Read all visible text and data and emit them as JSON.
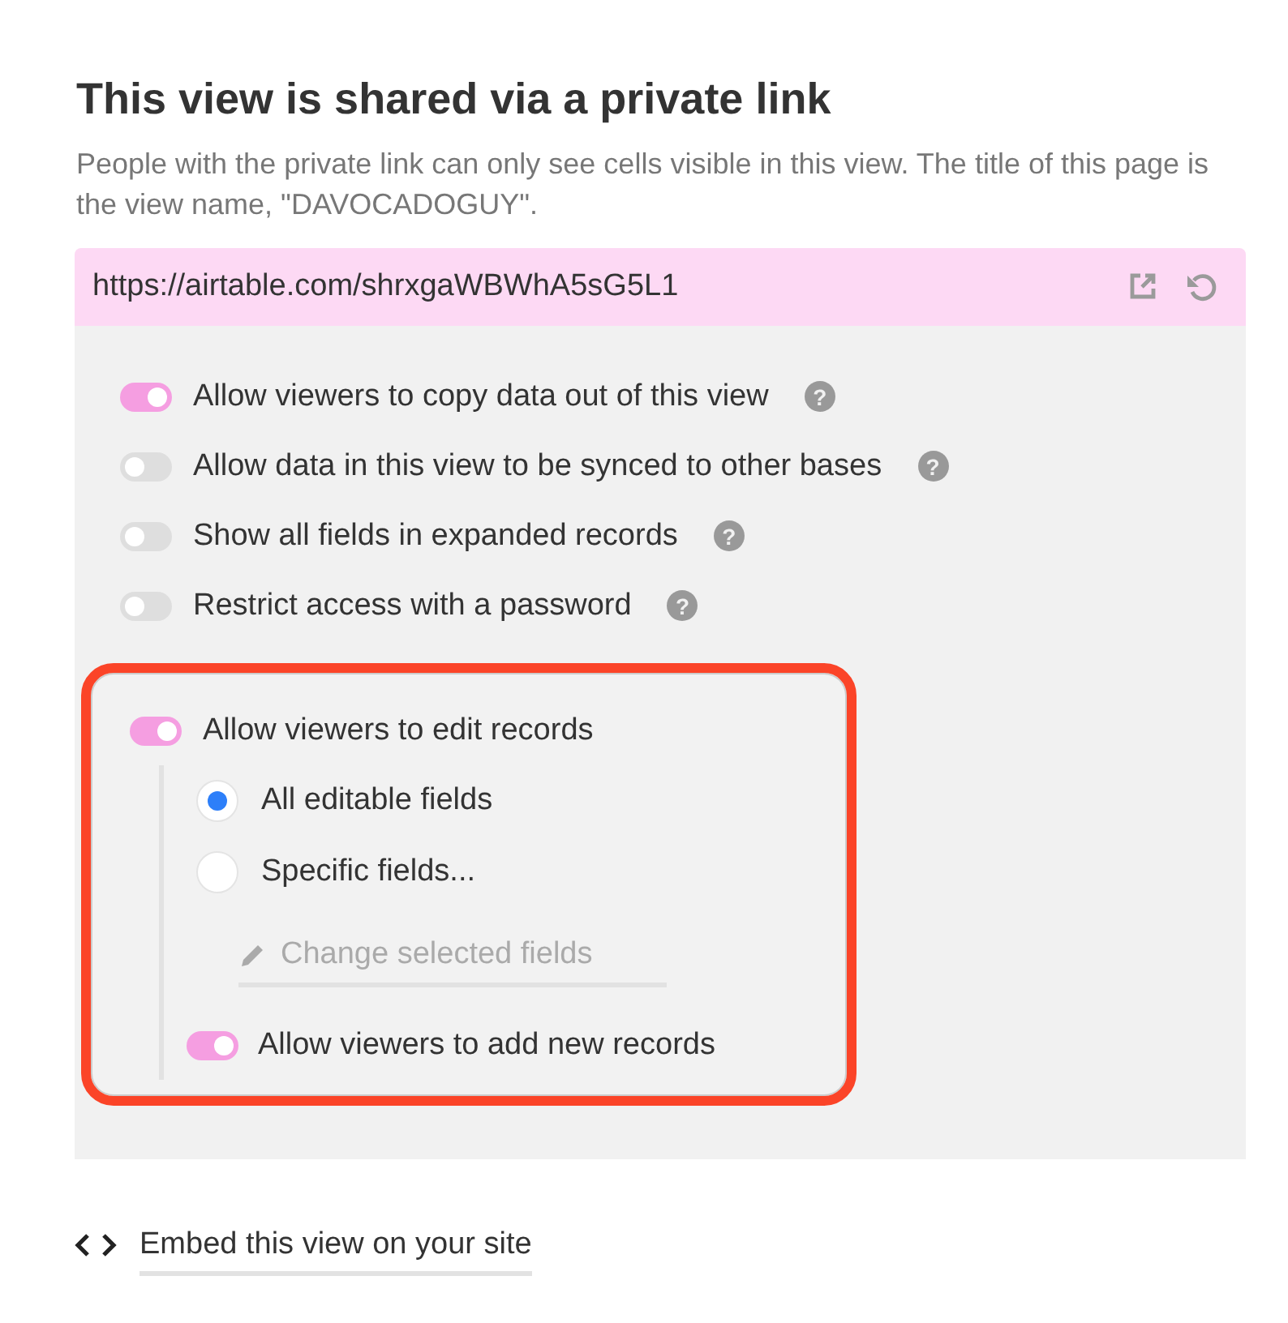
{
  "title": "This view is shared via a private link",
  "description": "People with the private link can only see cells visible in this view. The title of this page is the view name, \"DAVOCADOGUY\".",
  "link": {
    "url": "https://airtable.com/shrxgaWBWhA5sG5L1"
  },
  "options": [
    {
      "label": "Allow viewers to copy data out of this view",
      "on": true,
      "help": "?"
    },
    {
      "label": "Allow data in this view to be synced to other bases",
      "on": false,
      "help": "?"
    },
    {
      "label": "Show all fields in expanded records",
      "on": false,
      "help": "?"
    },
    {
      "label": "Restrict access with a password",
      "on": false,
      "help": "?"
    }
  ],
  "edit_section": {
    "highlighted": true,
    "label": "Allow viewers to edit records",
    "on": true,
    "radios": [
      {
        "label": "All editable fields",
        "selected": true
      },
      {
        "label": "Specific fields...",
        "selected": false
      }
    ],
    "change_button": {
      "label": "Change selected fields",
      "disabled": true
    },
    "sub_option": {
      "label": "Allow viewers to add new records",
      "on": true
    }
  },
  "embed_link": {
    "label": "Embed this view on your site"
  }
}
